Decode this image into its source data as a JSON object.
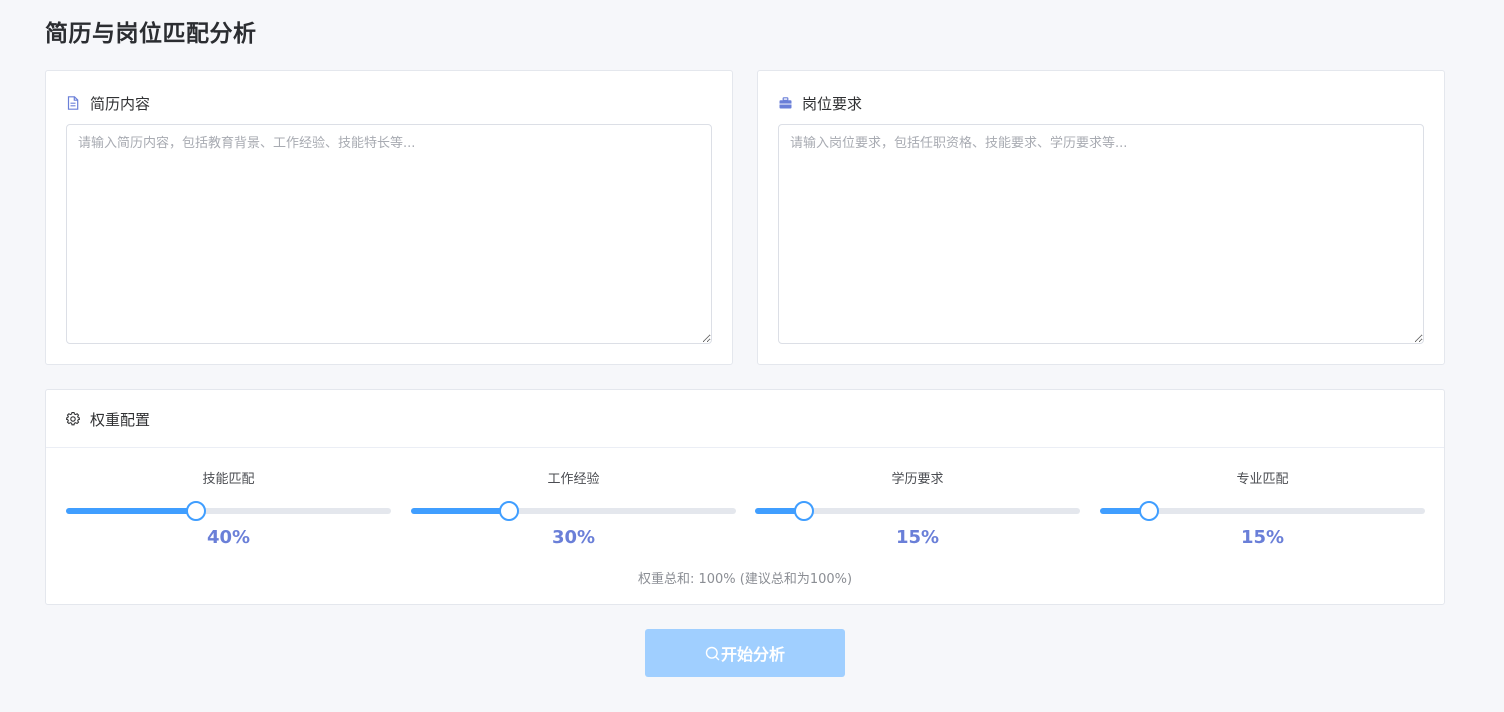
{
  "page": {
    "title": "简历与岗位匹配分析"
  },
  "resume": {
    "title": "简历内容",
    "icon": "document-icon",
    "placeholder": "请输入简历内容，包括教育背景、工作经验、技能特长等..."
  },
  "job": {
    "title": "岗位要求",
    "icon": "briefcase-icon",
    "placeholder": "请输入岗位要求，包括任职资格、技能要求、学历要求等..."
  },
  "weights": {
    "title": "权重配置",
    "icon": "gear-icon",
    "sliders": [
      {
        "label": "技能匹配",
        "value": 40,
        "display": "40%"
      },
      {
        "label": "工作经验",
        "value": 30,
        "display": "30%"
      },
      {
        "label": "学历要求",
        "value": 15,
        "display": "15%"
      },
      {
        "label": "专业匹配",
        "value": 15,
        "display": "15%"
      }
    ],
    "slider_max": 100,
    "sum_text": "权重总和: 100% (建议总和为100%)"
  },
  "action": {
    "analyze_label": "开始分析",
    "icon": "search-icon"
  },
  "colors": {
    "accent": "#409eff",
    "value_text": "#6a7fd8",
    "button_disabled": "#a0cfff"
  }
}
